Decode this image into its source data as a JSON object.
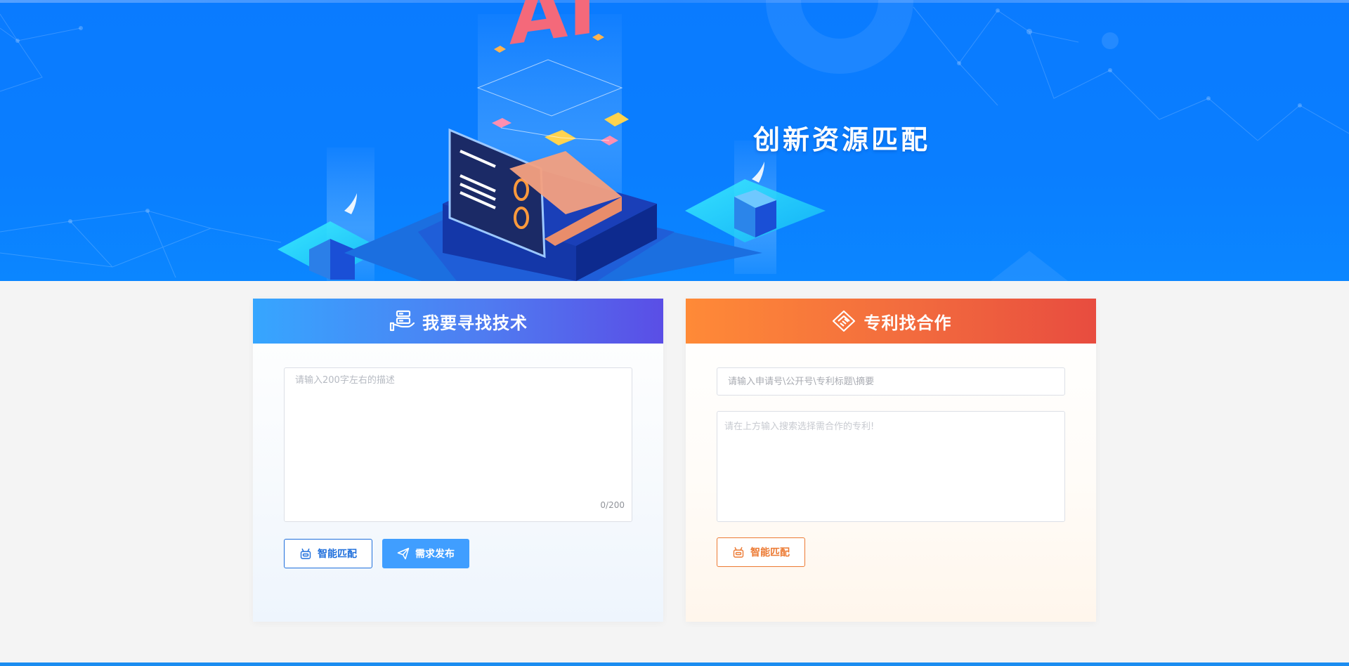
{
  "banner": {
    "title": "创新资源匹配",
    "art_text": "AI"
  },
  "find_tech": {
    "title": "我要寻找技术",
    "textarea_placeholder": "请输入200字左右的描述",
    "counter": "0/200",
    "smart_match_label": "智能匹配",
    "publish_label": "需求发布"
  },
  "patent": {
    "title": "专利找合作",
    "search_placeholder": "请输入申请号\\公开号\\专利标题\\摘要",
    "result_hint": "请在上方输入搜索选择需合作的专利!",
    "smart_match_label": "智能匹配"
  },
  "colors": {
    "banner_blue": "#0a7bff",
    "primary_blue": "#409eff",
    "accent_orange": "#ec7a33"
  }
}
